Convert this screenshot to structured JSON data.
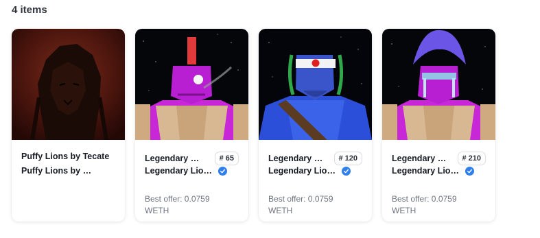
{
  "items_count_label": "4 items",
  "colors": {
    "verified": "#2f80ed",
    "muted_text": "#6e7480"
  },
  "cards": [
    {
      "name": "Puffy Lions by Tecate",
      "collection": "Puffy Lions by Tecate",
      "image": "lion-art",
      "verified": false
    },
    {
      "name": "Legendary Lions by Tecate",
      "badge": "65",
      "collection": "Legendary Lions by Tecate",
      "verified": true,
      "offer_label": "Best offer: 0.0759",
      "currency": "WETH",
      "image": "purple-warrior-mohawk"
    },
    {
      "name": "Legendary Lions by Tecate",
      "badge": "120",
      "collection": "Legendary Lions by Tecate",
      "verified": true,
      "offer_label": "Best offer: 0.0759",
      "currency": "WETH",
      "image": "blue-warrior-headband"
    },
    {
      "name": "Legendary Lions by Tecate",
      "badge": "210",
      "collection": "Legendary Lions by Tecate",
      "verified": true,
      "offer_label": "Best offer: 0.0759",
      "currency": "WETH",
      "image": "purple-warrior-blue-hair"
    }
  ]
}
